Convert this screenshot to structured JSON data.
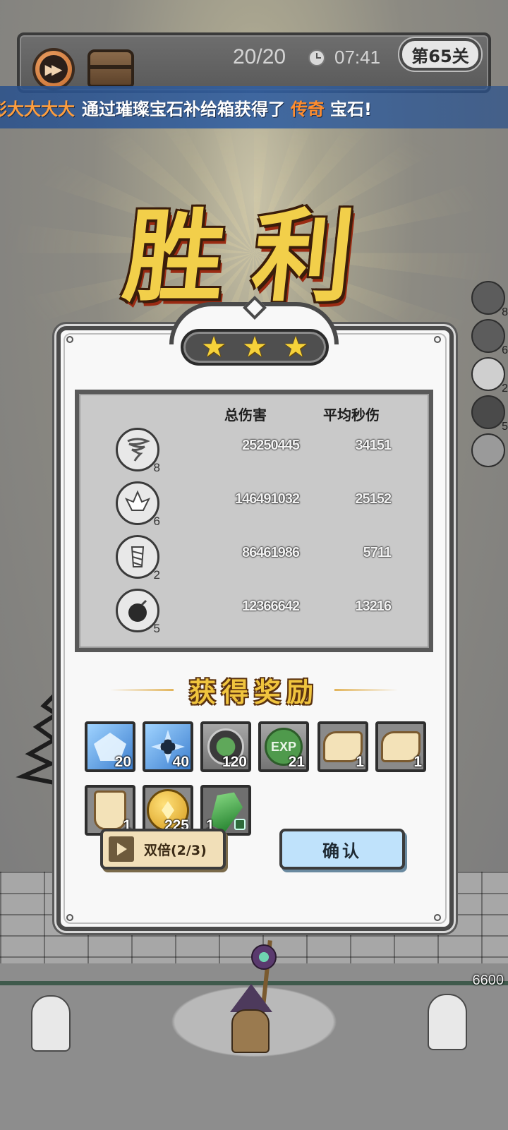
{
  "hud": {
    "wave": "20/20",
    "timer": "07:41",
    "level": "第65关",
    "fast_forward_icon": "fast-forward-icon",
    "chest_icon": "treasure-chest-icon"
  },
  "ticker": {
    "name": "彭大大大大",
    "middle": "通过璀璨宝石补给箱获得了",
    "rarity": "传奇",
    "end": "宝石!"
  },
  "victory": "胜利",
  "stars": [
    "★",
    "★",
    "★"
  ],
  "stats": {
    "col_total": "总伤害",
    "col_dps": "平均秒伤",
    "rows": [
      {
        "icon": "tornado-tower-icon",
        "level": "8",
        "total": "25250445",
        "dps": "34151"
      },
      {
        "icon": "crystal-tower-icon",
        "level": "6",
        "total": "146491032",
        "dps": "25152"
      },
      {
        "icon": "drill-tower-icon",
        "level": "2",
        "total": "86461986",
        "dps": "5711"
      },
      {
        "icon": "bomb-tower-icon",
        "level": "5",
        "total": "12366642",
        "dps": "13216"
      }
    ]
  },
  "reward_title": "获得奖励",
  "rewards": [
    {
      "name": "crystal-card-reward",
      "icon": "crystal-card-icon",
      "qty": "20"
    },
    {
      "name": "ice-card-reward",
      "icon": "ice-card-icon",
      "qty": "40"
    },
    {
      "name": "green-emblem-reward",
      "icon": "green-emblem-icon",
      "qty": "120"
    },
    {
      "name": "exp-reward",
      "icon": "exp-icon",
      "icon_text": "EXP",
      "qty": "21"
    },
    {
      "name": "scroll-rope-reward",
      "icon": "scroll-icon",
      "qty": "1"
    },
    {
      "name": "scroll-hat-reward",
      "icon": "scroll-icon",
      "qty": "1"
    },
    {
      "name": "scroll-cloak-reward",
      "icon": "scroll-icon",
      "qty": "1"
    },
    {
      "name": "gold-coin-reward",
      "icon": "gold-coin-icon",
      "qty": "225"
    },
    {
      "name": "emerald-reward",
      "icon": "emerald-icon",
      "qty": "1"
    }
  ],
  "buttons": {
    "double": "双倍(2/3)",
    "confirm": "确认"
  },
  "side_towers": [
    {
      "icon": "tornado-tower-icon",
      "level": "8"
    },
    {
      "icon": "crystal-tower-icon",
      "level": "6"
    },
    {
      "icon": "drill-tower-icon",
      "level": "2"
    },
    {
      "icon": "bomb-tower-icon",
      "level": "5"
    },
    {
      "icon": "empty-slot-icon",
      "level": ""
    }
  ],
  "base_hp": "6600",
  "colors": {
    "accent_gold": "#f2cf4a",
    "confirm_blue": "#bfe2fb",
    "double_tan": "#f1dfb8",
    "ticker_orange": "#ff9e3d"
  }
}
